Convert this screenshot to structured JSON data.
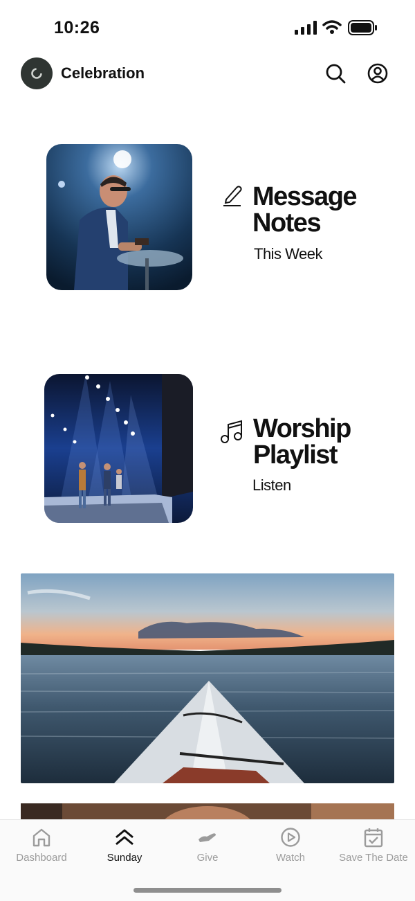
{
  "status_bar": {
    "time": "10:26"
  },
  "header": {
    "title": "Celebration"
  },
  "features": [
    {
      "title": "Message\nNotes",
      "subtitle": "This Week",
      "icon": "pencil-icon"
    },
    {
      "title": "Worship\nPlaylist",
      "subtitle": "Listen",
      "icon": "music-note-icon"
    }
  ],
  "tabs": [
    {
      "label": "Dashboard",
      "icon": "home-icon",
      "active": false
    },
    {
      "label": "Sunday",
      "icon": "chevrons-up-icon",
      "active": true
    },
    {
      "label": "Give",
      "icon": "give-hand-icon",
      "active": false
    },
    {
      "label": "Watch",
      "icon": "play-circle-icon",
      "active": false
    },
    {
      "label": "Save The Date",
      "icon": "calendar-check-icon",
      "active": false
    }
  ],
  "colors": {
    "background": "#ffffff",
    "text": "#111111",
    "tab_inactive": "#9b9b9b"
  }
}
